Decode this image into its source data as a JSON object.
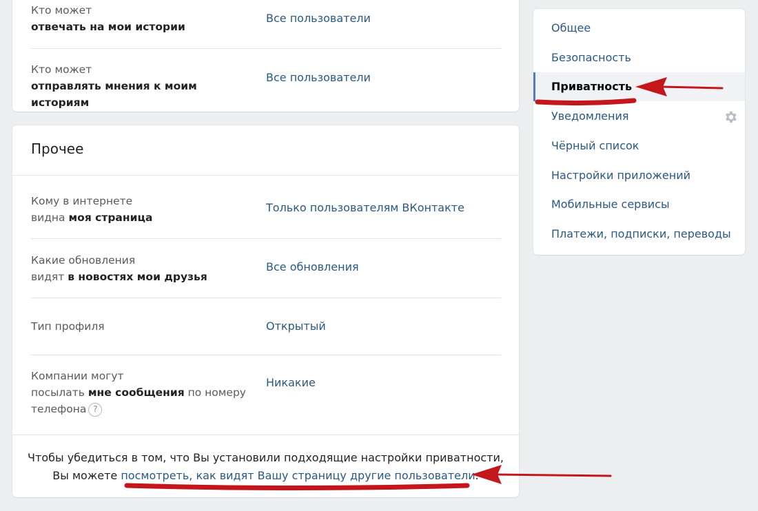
{
  "top_section": {
    "rows": [
      {
        "label_prefix": "Кто может",
        "label_bold": "отвечать на мои истории",
        "value": "Все пользователи"
      },
      {
        "label_prefix": "Кто может",
        "label_bold": "отправлять мнения к моим историям",
        "value": "Все пользователи"
      }
    ]
  },
  "misc_section": {
    "title": "Прочее",
    "rows": [
      {
        "label_line1": "Кому в интернете",
        "label_line2_prefix": "видна ",
        "label_line2_bold": "моя страница",
        "value": "Только пользователям ВКонтакте"
      },
      {
        "label_line1": "Какие обновления",
        "label_line2_prefix": "видят ",
        "label_line2_bold": "в новостях мои друзья",
        "value": "Все обновления"
      },
      {
        "label": "Тип профиля",
        "value": "Открытый"
      },
      {
        "label_line1": "Компании могут",
        "label_line2_prefix": "посылать ",
        "label_line2_bold": "мне сообщения",
        "label_line2_suffix": " по номеру",
        "label_line3": "телефона",
        "help": "?",
        "value": "Никакие"
      }
    ],
    "footer": {
      "line1": "Чтобы убедиться в том, что Вы установили подходящие настройки приватности,",
      "line2_prefix": "Вы можете ",
      "link": "посмотреть, как видят Вашу страницу другие пользователи",
      "line2_suffix": "."
    }
  },
  "side_menu": {
    "items": [
      {
        "label": "Общее"
      },
      {
        "label": "Безопасность"
      },
      {
        "label": "Приватность",
        "active": true
      },
      {
        "label": "Уведомления"
      },
      {
        "label": "Чёрный список"
      },
      {
        "label": "Настройки приложений"
      },
      {
        "label": "Мобильные сервисы"
      },
      {
        "label": "Платежи, подписки, переводы"
      }
    ],
    "gear_icon": "gear-icon"
  },
  "colors": {
    "link": "#2a5885",
    "background": "#edeef0",
    "active_marker": "#5181b8",
    "annotation": "#c4171c"
  }
}
